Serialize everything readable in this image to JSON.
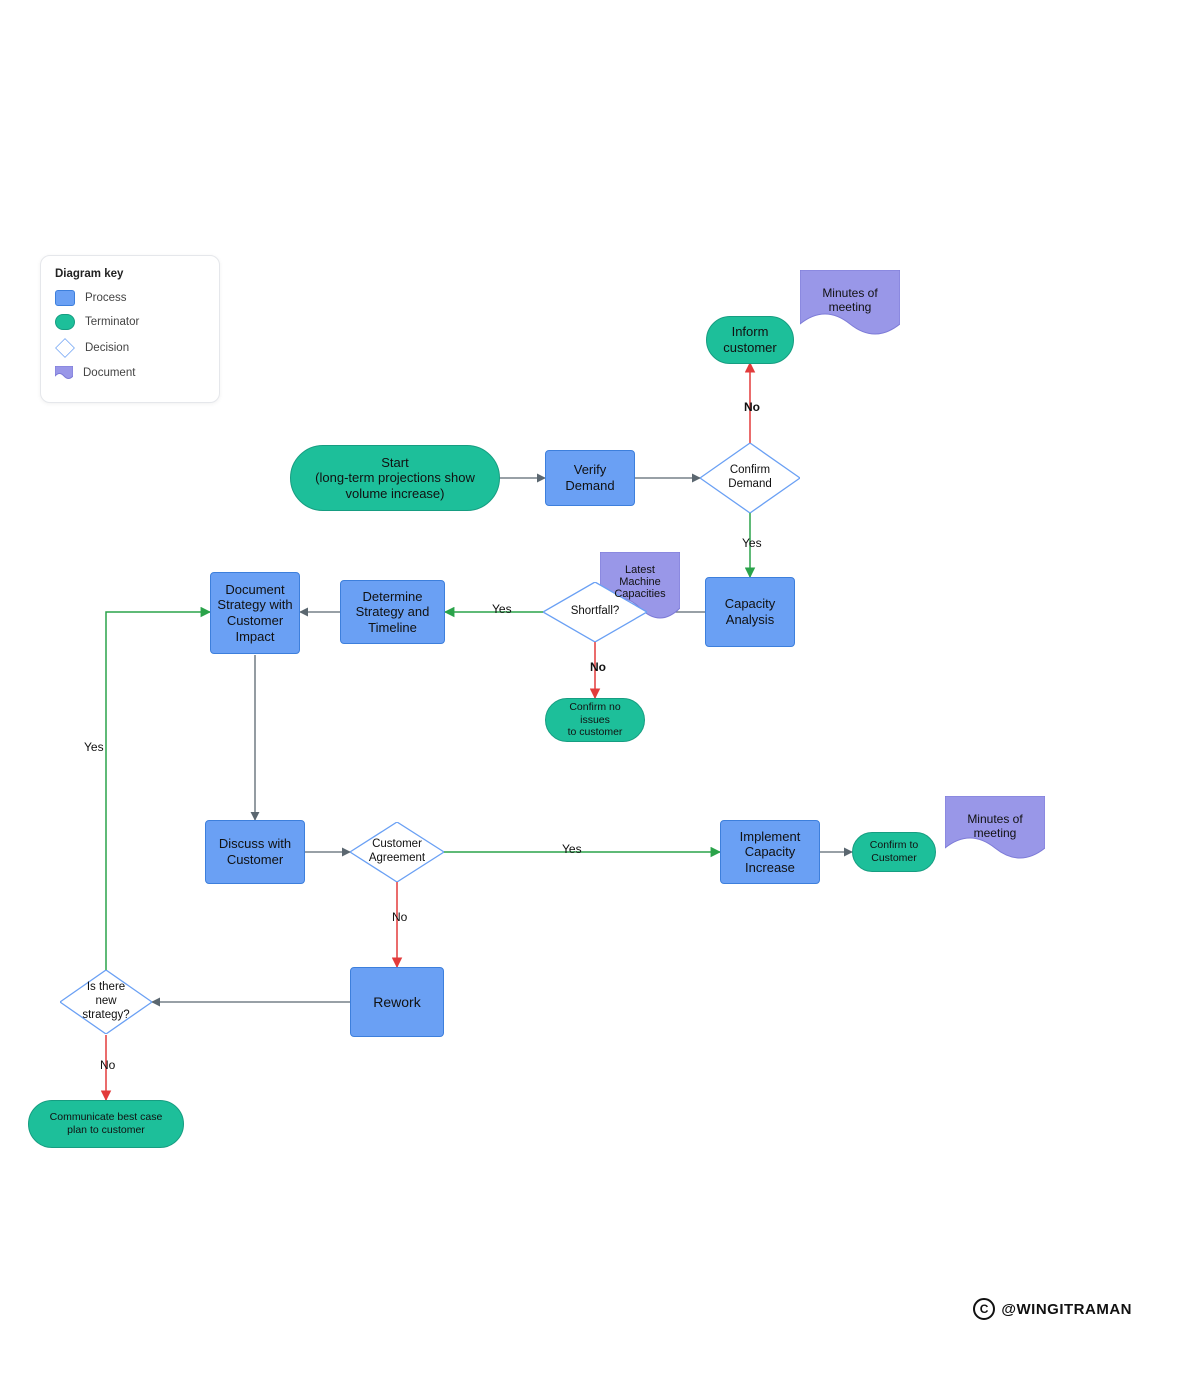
{
  "legend": {
    "title": "Diagram key",
    "items": [
      {
        "label": "Process"
      },
      {
        "label": "Terminator"
      },
      {
        "label": "Decision"
      },
      {
        "label": "Document"
      }
    ]
  },
  "nodes": {
    "start": "Start\n(long-term projections show\nvolume increase)",
    "verify_demand": "Verify\nDemand",
    "confirm_demand": "Confirm\nDemand",
    "inform_customer": "Inform\ncustomer",
    "minutes_top": "Minutes of\nmeeting",
    "capacity_analysis": "Capacity\nAnalysis",
    "latest_machine": "Latest\nMachine\nCapacities",
    "shortfall": "Shortfall?",
    "confirm_no_issues": "Confirm no issues\nto customer",
    "determine_strategy": "Determine\nStrategy and\nTimeline",
    "document_strategy": "Document\nStrategy with\nCustomer\nImpact",
    "discuss_customer": "Discuss with\nCustomer",
    "customer_agreement": "Customer\nAgreement",
    "implement_capacity": "Implement\nCapacity\nIncrease",
    "confirm_to_customer": "Confirm to\nCustomer",
    "minutes_bottom": "Minutes of\nmeeting",
    "rework": "Rework",
    "new_strategy": "Is there new\nstrategy?",
    "communicate_plan": "Communicate best case\nplan to customer"
  },
  "edges": {
    "confirm_demand_no": "No",
    "confirm_demand_yes": "Yes",
    "shortfall_yes": "Yes",
    "shortfall_no": "No",
    "cust_agree_yes": "Yes",
    "cust_agree_no": "No",
    "new_strategy_yes": "Yes",
    "new_strategy_no": "No"
  },
  "watermark": "@WINGITRAMAN",
  "colors": {
    "process_fill": "#6aa0f4",
    "process_stroke": "#3d7fdc",
    "terminator_fill": "#1dbf9a",
    "terminator_stroke": "#169d81",
    "decision_stroke": "#6aa0f4",
    "document_fill": "#9997e8",
    "document_stroke": "#7d7bd7",
    "arrow_default": "#5b6770",
    "arrow_yes": "#2aa34a",
    "arrow_no": "#e23b3b"
  }
}
